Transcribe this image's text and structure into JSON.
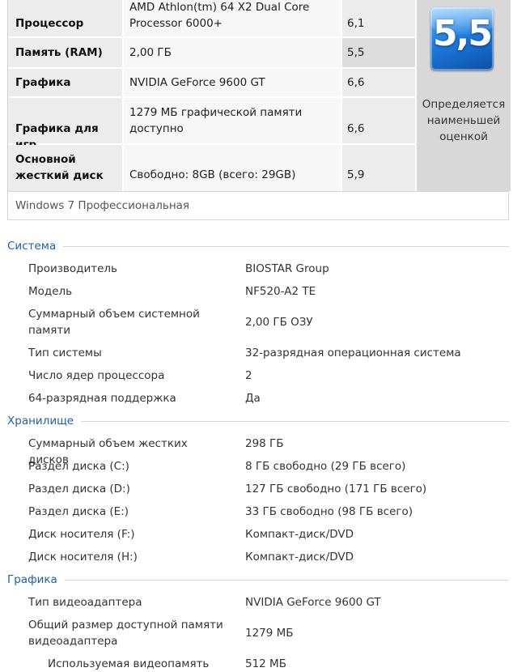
{
  "rating": {
    "rows": [
      {
        "component": "Процессор",
        "details": "AMD Athlon(tm) 64 X2 Dual Core\nProcessor 6000+",
        "score": "6,1"
      },
      {
        "component": "Память (RAM)",
        "details": "2,00 ГБ",
        "score": "5,5"
      },
      {
        "component": "Графика",
        "details": "NVIDIA GeForce 9600 GT",
        "score": "6,6"
      },
      {
        "component": "Графика для игр",
        "details": "1279 МБ графической памяти доступно",
        "score": "6,6"
      },
      {
        "component": "Основной жесткий диск",
        "details": "Свободно: 8GB (всего: 29GB)",
        "score": "5,9"
      }
    ],
    "base_score": "5,5",
    "base_score_note": "Определяется наименьшей оценкой",
    "edition": "Windows 7 Профессиональная"
  },
  "system": {
    "title": "Система",
    "rows": [
      {
        "label": "Производитель",
        "value": "BIOSTAR Group"
      },
      {
        "label": "Модель",
        "value": "NF520-A2 TE"
      },
      {
        "label": "Суммарный объем системной памяти",
        "value": "2,00 ГБ ОЗУ"
      },
      {
        "label": "Тип системы",
        "value": "32-разрядная операционная система"
      },
      {
        "label": "Число ядер процессора",
        "value": "2"
      },
      {
        "label": "64-разрядная поддержка",
        "value": "Да"
      }
    ]
  },
  "storage": {
    "title": "Хранилище",
    "rows": [
      {
        "label": "Суммарный объем жестких дисков",
        "value": "298 ГБ"
      },
      {
        "label": "Раздел диска (C:)",
        "value": "8 ГБ свободно (29 ГБ всего)"
      },
      {
        "label": "Раздел диска (D:)",
        "value": "127 ГБ свободно (171 ГБ всего)"
      },
      {
        "label": "Раздел диска (E:)",
        "value": "33 ГБ свободно (98 ГБ всего)"
      },
      {
        "label": "Диск носителя (F:)",
        "value": "Компакт-диск/DVD"
      },
      {
        "label": "Диск носителя (H:)",
        "value": "Компакт-диск/DVD"
      }
    ]
  },
  "graphics": {
    "title": "Графика",
    "rows": [
      {
        "label": "Тип видеоадаптера",
        "value": "NVIDIA GeForce 9600 GT"
      },
      {
        "label": "Общий размер доступной памяти видеоадаптера",
        "value": "1279 МБ"
      },
      {
        "label": "Используемая видеопамять",
        "value": "512 МБ"
      }
    ]
  },
  "colors": {
    "section_title": "#1f5fa8",
    "badge": "#1f7ede"
  }
}
